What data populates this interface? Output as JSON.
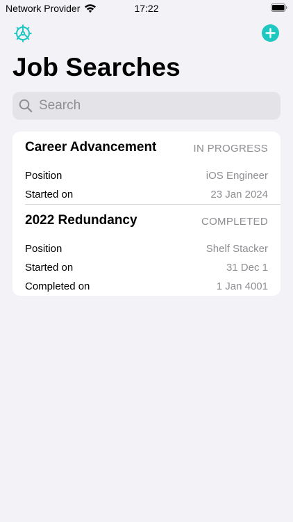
{
  "status_bar": {
    "carrier": "Network Provider",
    "time": "17:22"
  },
  "toolbar": {
    "settings_icon": "gear-icon",
    "add_icon": "plus-circle-icon"
  },
  "page": {
    "title": "Job Searches"
  },
  "search": {
    "placeholder": "Search",
    "value": ""
  },
  "colors": {
    "accent": "#1fc7c1",
    "background": "#f2f2f7",
    "secondary_text": "#8e8e93",
    "search_fill": "#e3e3e8"
  },
  "jobs": [
    {
      "title": "Career Advancement",
      "status": "IN PROGRESS",
      "rows": [
        {
          "label": "Position",
          "value": "iOS Engineer"
        },
        {
          "label": "Started on",
          "value": "23 Jan 2024"
        }
      ]
    },
    {
      "title": "2022 Redundancy",
      "status": "COMPLETED",
      "rows": [
        {
          "label": "Position",
          "value": "Shelf Stacker"
        },
        {
          "label": "Started on",
          "value": "31 Dec 1"
        },
        {
          "label": "Completed on",
          "value": "1 Jan 4001"
        }
      ]
    }
  ]
}
